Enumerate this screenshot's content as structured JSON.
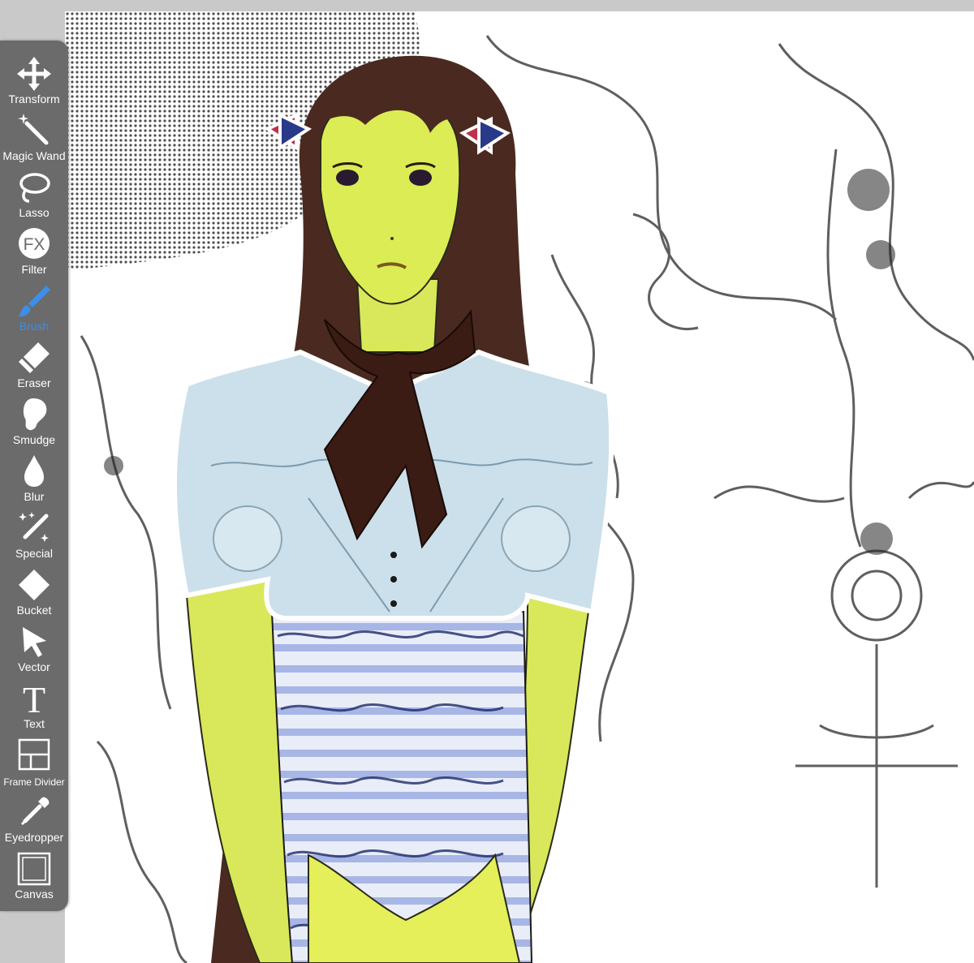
{
  "app": {
    "accent_color": "#3d8ee8",
    "panel_color": "#6b6b6b"
  },
  "toolbar": {
    "active_tool": "Brush",
    "tools": [
      {
        "label": "Transform",
        "icon": "move-arrows-icon"
      },
      {
        "label": "Magic Wand",
        "icon": "magic-wand-icon"
      },
      {
        "label": "Lasso",
        "icon": "lasso-icon"
      },
      {
        "label": "Filter",
        "icon": "fx-filter-icon",
        "icon_text": "FX"
      },
      {
        "label": "Brush",
        "icon": "brush-icon",
        "active": true
      },
      {
        "label": "Eraser",
        "icon": "eraser-icon"
      },
      {
        "label": "Smudge",
        "icon": "smudge-finger-icon"
      },
      {
        "label": "Blur",
        "icon": "droplet-icon"
      },
      {
        "label": "Special",
        "icon": "sparkle-pen-icon"
      },
      {
        "label": "Bucket",
        "icon": "paint-bucket-icon"
      },
      {
        "label": "Vector",
        "icon": "vector-cursor-icon"
      },
      {
        "label": "Text",
        "icon": "text-t-icon",
        "icon_text": "T"
      },
      {
        "label": "Frame Divider",
        "icon": "frame-divider-icon"
      },
      {
        "label": "Eyedropper",
        "icon": "eyedropper-icon"
      },
      {
        "label": "Canvas",
        "icon": "canvas-square-icon"
      }
    ]
  }
}
